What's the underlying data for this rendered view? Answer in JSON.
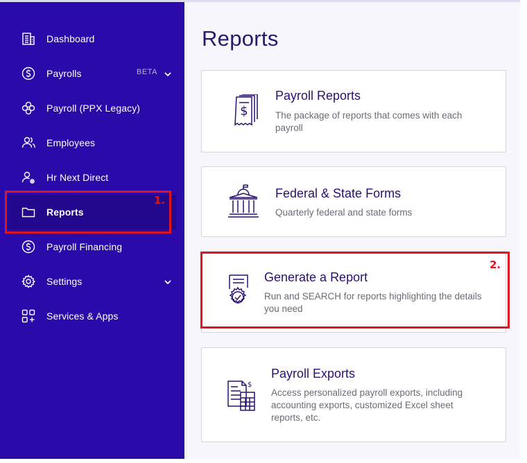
{
  "sidebar": {
    "items": [
      {
        "label": "Dashboard",
        "icon": "building-icon"
      },
      {
        "label": "Payrolls",
        "icon": "dollar-circle-icon",
        "badge": "BETA"
      },
      {
        "label": "Payroll (PPX Legacy)",
        "icon": "flower-icon"
      },
      {
        "label": "Employees",
        "icon": "users-icon"
      },
      {
        "label": "Hr Next Direct",
        "icon": "user-gear-icon"
      },
      {
        "label": "Reports",
        "icon": "folder-icon"
      },
      {
        "label": "Payroll Financing",
        "icon": "dollar-circle-icon"
      },
      {
        "label": "Settings",
        "icon": "gear-icon"
      },
      {
        "label": "Services & Apps",
        "icon": "apps-grid-icon"
      }
    ],
    "active": "Reports"
  },
  "annotations": {
    "one": "1.",
    "two": "2."
  },
  "main": {
    "title": "Reports",
    "cards": [
      {
        "title": "Payroll Reports",
        "desc": "The package of reports that comes with each payroll",
        "icon": "receipt-stack-icon"
      },
      {
        "title": "Federal & State Forms",
        "desc": "Quarterly federal and state forms",
        "icon": "government-building-icon"
      },
      {
        "title": "Generate a Report",
        "desc": "Run and SEARCH for reports highlighting the details you need",
        "icon": "report-gear-icon"
      },
      {
        "title": "Payroll Exports",
        "desc": "Access personalized payroll exports, including accounting exports, customized Excel sheet reports, etc.",
        "icon": "export-documents-icon"
      }
    ]
  },
  "colors": {
    "sidebar": "#2a0aa8",
    "annotation": "#e0141e",
    "title": "#2a1870"
  }
}
